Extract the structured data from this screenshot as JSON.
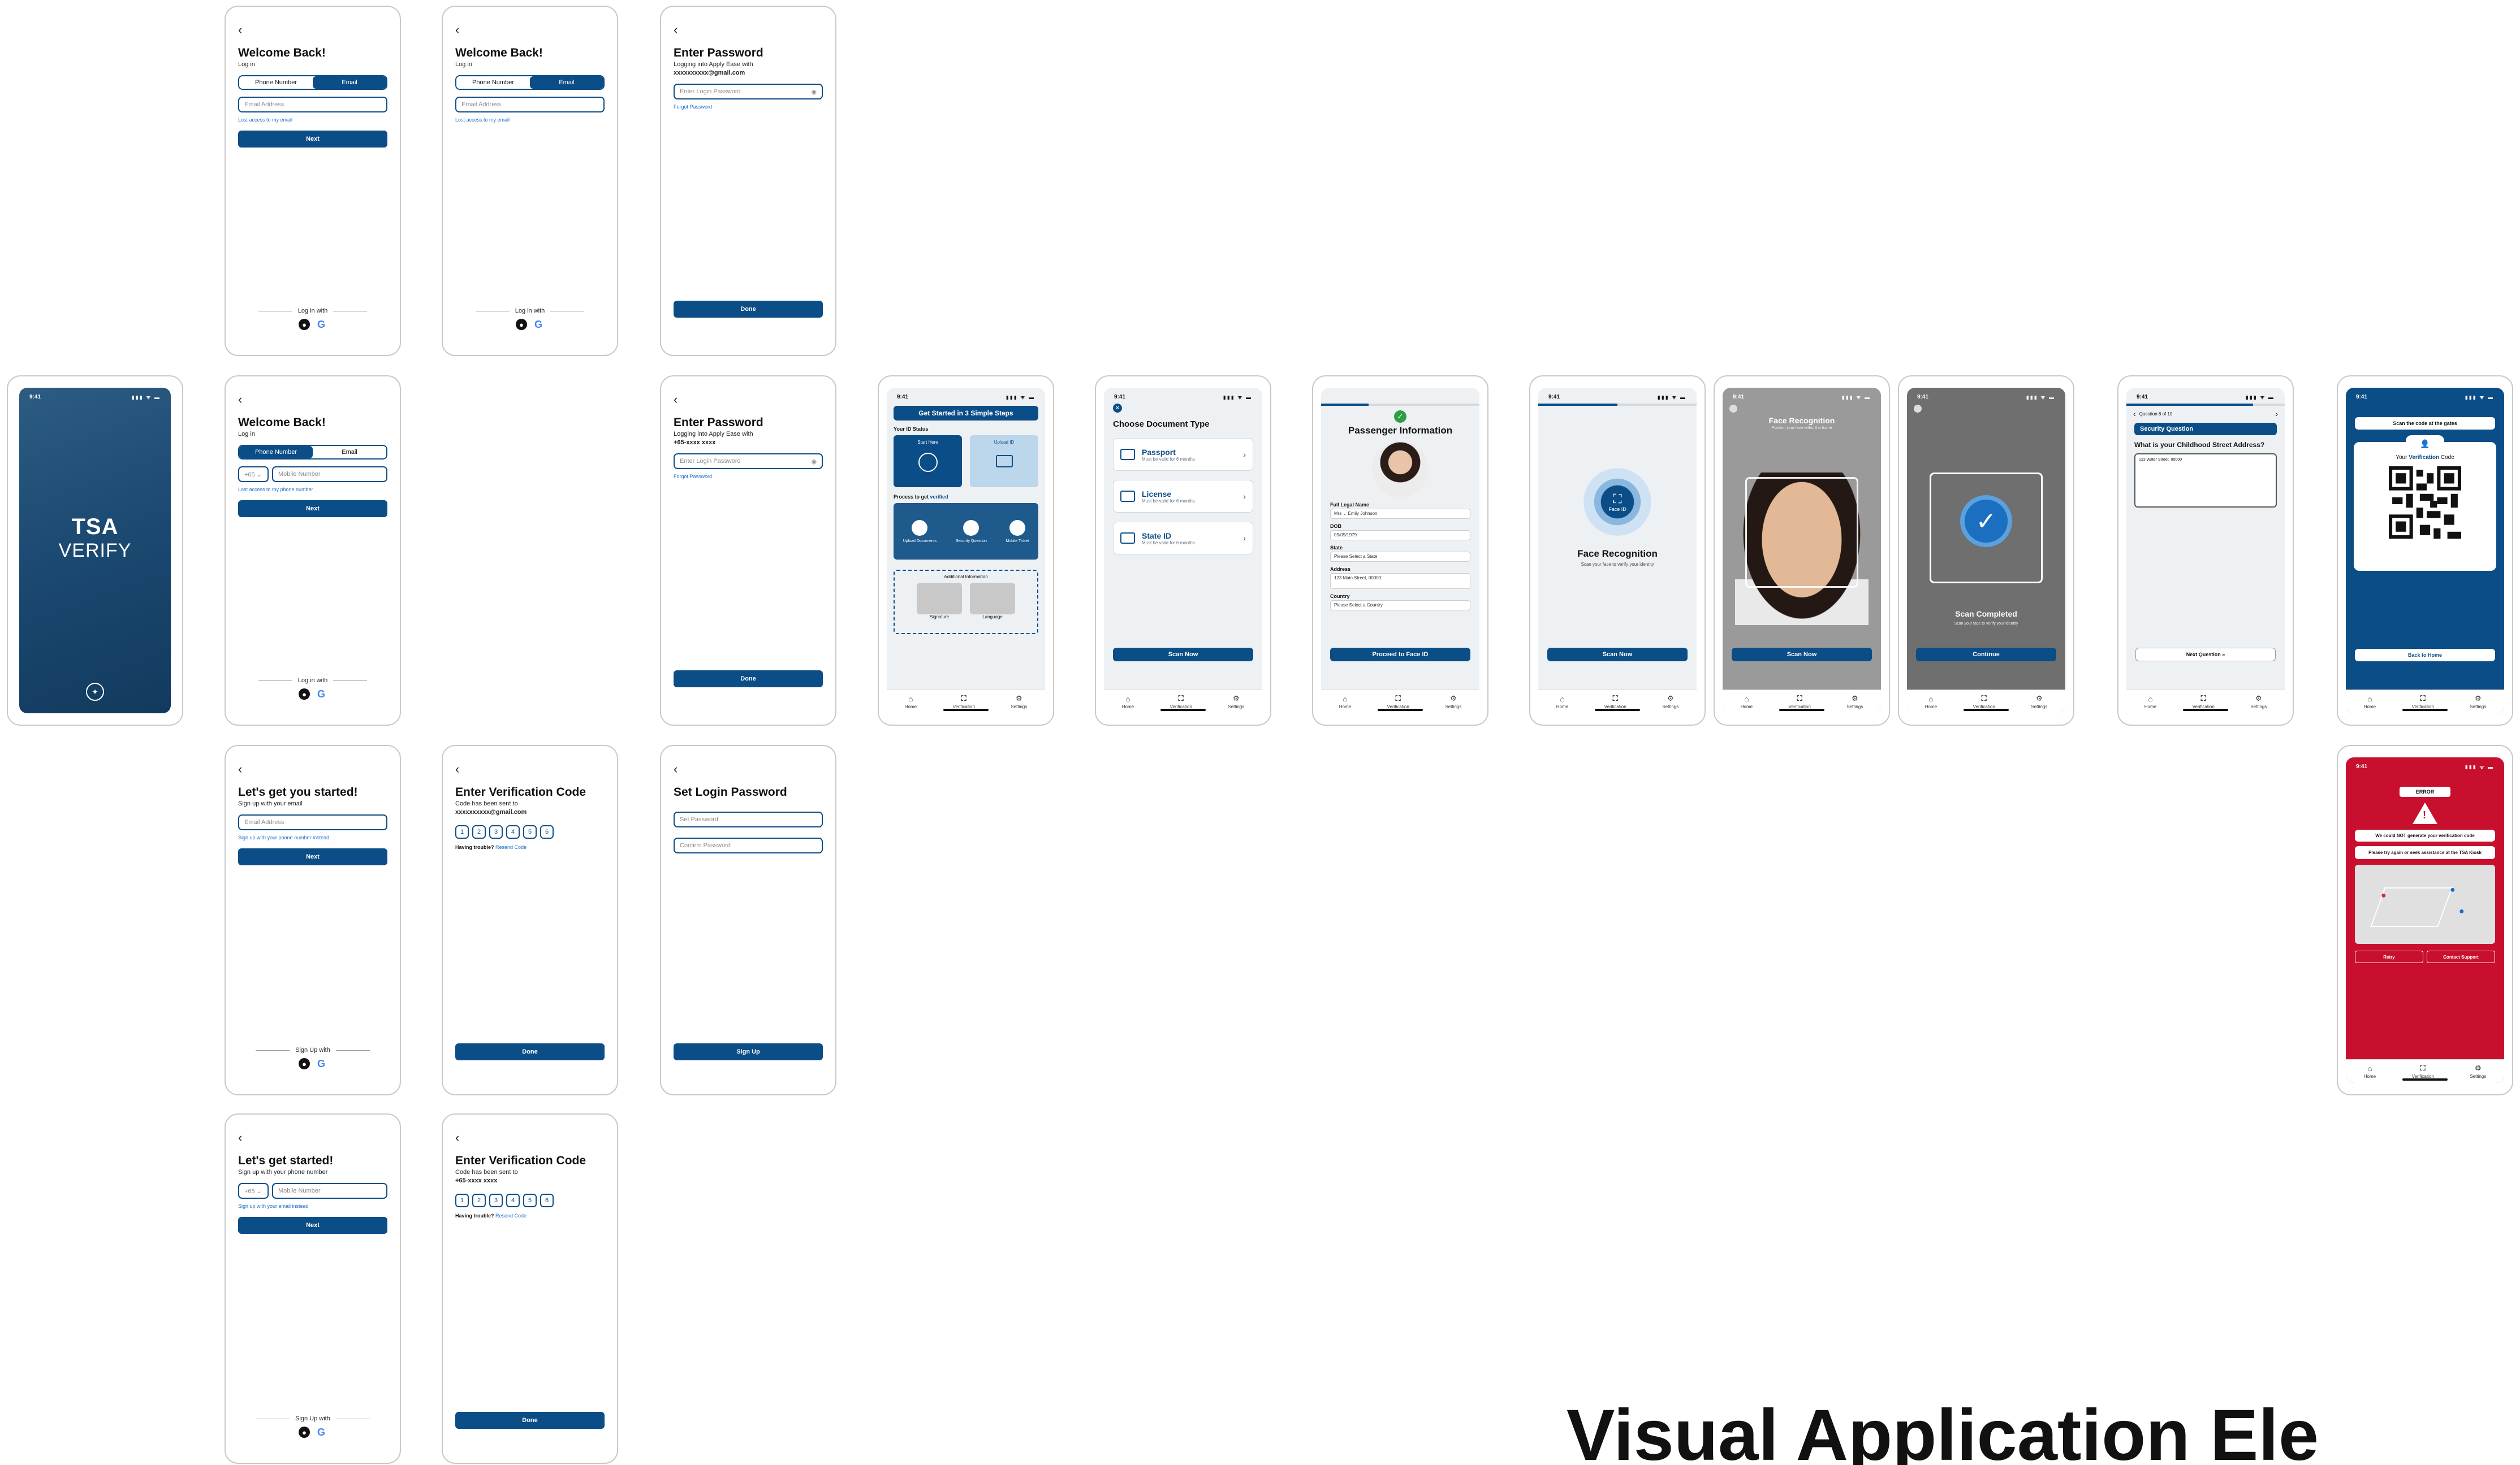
{
  "common": {
    "back": "‹",
    "time": "9:41",
    "indicators": "▮▮▮ ᯤ ▬",
    "nav": [
      "Home",
      "Verification",
      "Settings"
    ]
  },
  "login_email": {
    "title": "Welcome Back!",
    "subtitle": "Log in",
    "tab_phone": "Phone Number",
    "tab_email": "Email",
    "email_placeholder": "Email Address",
    "lost_access": "Lost access to my email",
    "next": "Next",
    "login_with": "Log in with"
  },
  "login_phone": {
    "title": "Welcome Back!",
    "subtitle": "Log in",
    "tab_phone": "Phone Number",
    "tab_email": "Email",
    "country_code": "+65 ⌄",
    "phone_placeholder": "Mobile Number",
    "lost_access": "Lost access to my phone number",
    "next": "Next",
    "login_with": "Log in with"
  },
  "enter_password_email": {
    "title": "Enter Password",
    "line1": "Logging into Apply Ease with",
    "account": "xxxxxxxxxx@gmail.com",
    "placeholder": "Enter Login Password",
    "forgot": "Forgot Password",
    "done": "Done"
  },
  "enter_password_phone": {
    "title": "Enter Password",
    "line1": "Logging into Apply Ease with",
    "account": "+65-xxxx xxxx",
    "placeholder": "Enter Login Password",
    "forgot": "Forgot Password",
    "done": "Done"
  },
  "signup_email": {
    "title": "Let's get you started!",
    "subtitle": "Sign up with your email",
    "email_placeholder": "Email Address",
    "alt_link": "Sign up with your phone number instead",
    "next": "Next",
    "signup_with": "Sign Up with"
  },
  "signup_phone": {
    "title": "Let's get started!",
    "subtitle": "Sign up with your phone number",
    "country_code": "+65 ⌄",
    "phone_placeholder": "Mobile Number",
    "alt_link": "Sign up with your email instead",
    "next": "Next",
    "signup_with": "Sign Up with"
  },
  "verify_email": {
    "title": "Enter Verification Code",
    "line1": "Code has been sent to",
    "account": "xxxxxxxxxx@gmail.com",
    "digits": [
      "1",
      "2",
      "3",
      "4",
      "5",
      "6"
    ],
    "trouble": "Having trouble?",
    "resend": "Resend Code",
    "done": "Done"
  },
  "verify_phone": {
    "title": "Enter Verification Code",
    "line1": "Code has been sent to",
    "account": "+65-xxxx xxxx",
    "digits": [
      "1",
      "2",
      "3",
      "4",
      "5",
      "6"
    ],
    "trouble": "Having trouble?",
    "resend": "Resend Code",
    "done": "Done"
  },
  "set_password": {
    "title": "Set Login Password",
    "set_placeholder": "Set Password",
    "confirm_placeholder": "Confirm Password",
    "signup": "Sign Up"
  },
  "splash": {
    "brand_top": "TSA",
    "brand_bottom": "VERIFY"
  },
  "home": {
    "banner": "Get Started in 3 Simple Steps",
    "id_status": "Your ID Status",
    "start_here": "Start Here",
    "upload_id": "Upload ID",
    "process": "Process to get",
    "process_em": "verified",
    "steps": [
      "Upload Documents",
      "Security Question",
      "Mobile Ticket"
    ],
    "additional": "Additional Information",
    "signature": "Signature",
    "language": "Language"
  },
  "choose_doc": {
    "title": "Choose Document Type",
    "docs": [
      {
        "name": "Passport",
        "desc": "Must be valid for 6 months"
      },
      {
        "name": "License",
        "desc": "Must be valid for 6 months"
      },
      {
        "name": "State ID",
        "desc": "Must be valid for 6 months"
      }
    ],
    "scan": "Scan Now"
  },
  "passenger": {
    "title": "Passenger Information",
    "fields": [
      {
        "label": "Full Legal Name",
        "value": "Mrs ⌄  Emily Johnson"
      },
      {
        "label": "DOB",
        "value": "09/09/1979"
      },
      {
        "label": "State",
        "value": "Please Select a State"
      },
      {
        "label": "Address",
        "value": "123 Main Street, 00000"
      },
      {
        "label": "Country",
        "value": "Please Select a Country"
      }
    ],
    "proceed": "Proceed to Face ID"
  },
  "face_intro": {
    "icon_label": "Face ID",
    "title": "Face Recognition",
    "desc": "Scan your face to verify your identity",
    "scan": "Scan Now"
  },
  "face_scan": {
    "title": "Face Recognition",
    "desc": "Position your face within the frame",
    "scan": "Scan Now"
  },
  "scan_done": {
    "title": "Scan Completed",
    "desc": "Scan your face to verify your identity",
    "continue": "Continue"
  },
  "security_q": {
    "counter": "Question 8 of 10",
    "banner": "Security Question",
    "question": "What is your Childhood Street Address?",
    "answer": "123 Water Street, 00000",
    "next": "Next Question »"
  },
  "qr": {
    "scan_note": "Scan the code at the gates",
    "title_pre": "Your",
    "title_em": "Verification",
    "title_post": "Code",
    "back_home": "Back to Home"
  },
  "error": {
    "badge": "ERROR",
    "msg1": "We could NOT generate your verification code",
    "msg2": "Please try again or seek assistance at the TSA Kiosk",
    "retry": "Retry",
    "support": "Contact Support"
  },
  "heading": "Visual Application Ele"
}
